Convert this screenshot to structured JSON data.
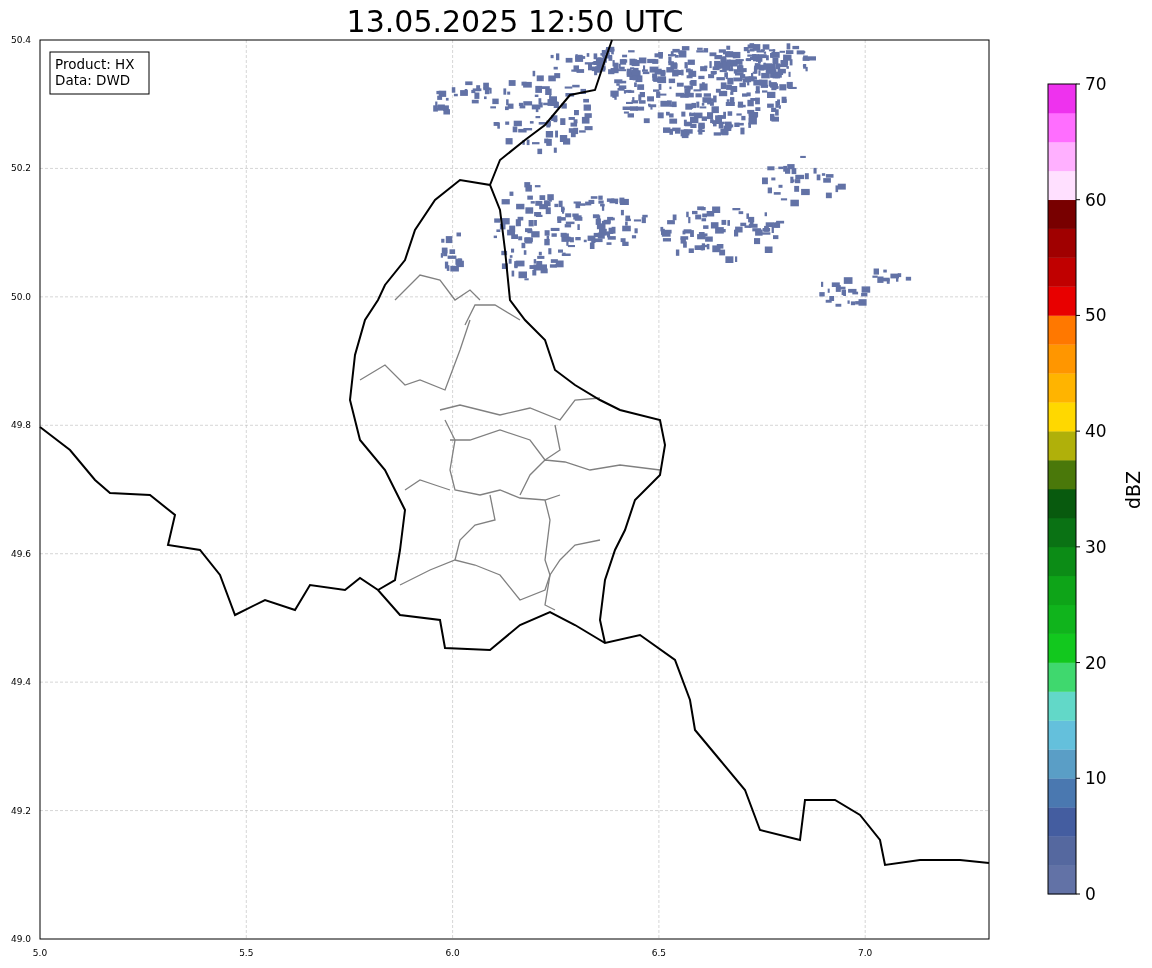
{
  "title": "13.05.2025 12:50 UTC",
  "info_box": [
    "Product: HX",
    "Data: DWD"
  ],
  "x_ticks": [
    "5.0",
    "5.5",
    "6.0",
    "6.5",
    "7.0"
  ],
  "y_ticks": [
    "50.4",
    "50.2",
    "50.0",
    "49.8",
    "49.6",
    "49.4",
    "49.2",
    "49.0"
  ],
  "colorbar": {
    "label": "dBZ",
    "ticks": [
      "70",
      "60",
      "50",
      "40",
      "30",
      "20",
      "10",
      "0"
    ],
    "segments": [
      {
        "color": "#6272a6"
      },
      {
        "color": "#55689f"
      },
      {
        "color": "#445da0"
      },
      {
        "color": "#4a78b0"
      },
      {
        "color": "#5a9ec6"
      },
      {
        "color": "#64c0dc"
      },
      {
        "color": "#62d8c8"
      },
      {
        "color": "#3fd86e"
      },
      {
        "color": "#12c81e"
      },
      {
        "color": "#10b41c"
      },
      {
        "color": "#0ea418"
      },
      {
        "color": "#0c8c16"
      },
      {
        "color": "#0a7214"
      },
      {
        "color": "#085a0e"
      },
      {
        "color": "#4a780a"
      },
      {
        "color": "#b0b00a"
      },
      {
        "color": "#ffd800"
      },
      {
        "color": "#ffb400"
      },
      {
        "color": "#ff9600"
      },
      {
        "color": "#ff7800"
      },
      {
        "color": "#e80000"
      },
      {
        "color": "#c00000"
      },
      {
        "color": "#a00000"
      },
      {
        "color": "#780000"
      },
      {
        "color": "#ffe0ff"
      },
      {
        "color": "#ffb0ff"
      },
      {
        "color": "#ff6eff"
      },
      {
        "color": "#ee32ee"
      }
    ]
  }
}
